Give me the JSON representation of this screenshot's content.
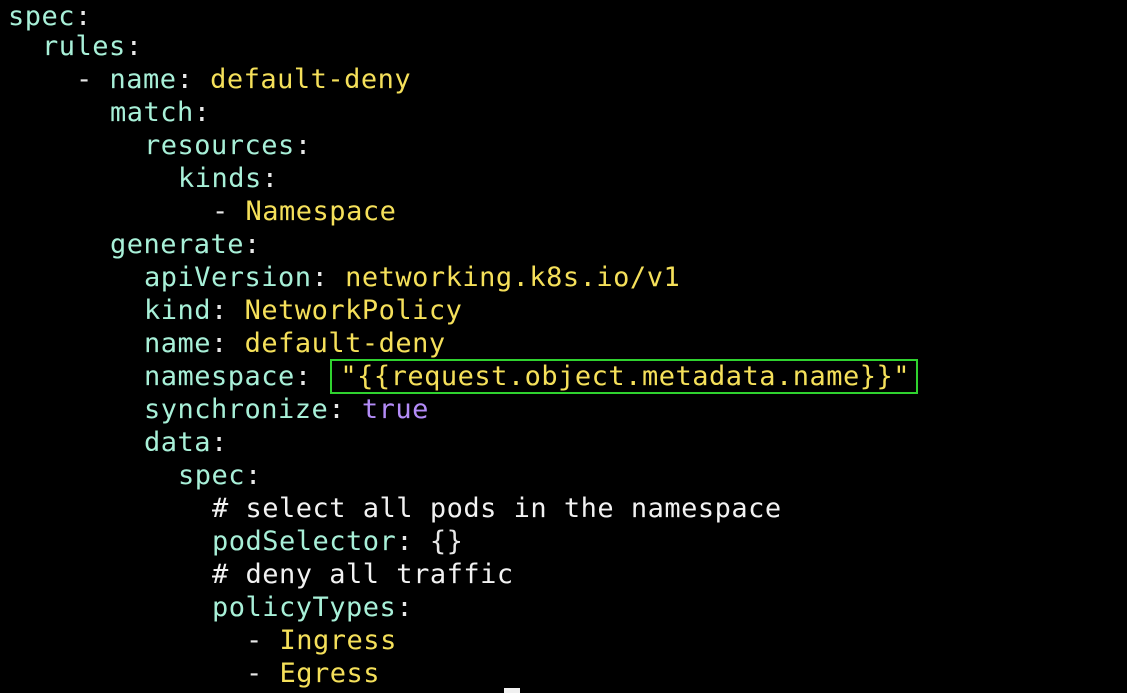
{
  "editor": {
    "lines": {
      "l1": {
        "key": "spec",
        "colon": ":"
      },
      "l2": {
        "key": "rules",
        "colon": ":"
      },
      "l3": {
        "dash": "-",
        "key": "name",
        "colon": ":",
        "value": "default-deny"
      },
      "l4": {
        "key": "match",
        "colon": ":"
      },
      "l5": {
        "key": "resources",
        "colon": ":"
      },
      "l6": {
        "key": "kinds",
        "colon": ":"
      },
      "l7": {
        "dash": "-",
        "value": "Namespace"
      },
      "l8": {
        "key": "generate",
        "colon": ":"
      },
      "l9": {
        "key": "apiVersion",
        "colon": ":",
        "value": "networking.k8s.io/v1"
      },
      "l10": {
        "key": "kind",
        "colon": ":",
        "value": "NetworkPolicy"
      },
      "l11": {
        "key": "name",
        "colon": ":",
        "value": "default-deny"
      },
      "l12": {
        "key": "namespace",
        "colon": ":",
        "value": "\"{{request.object.metadata.name}}\""
      },
      "l13": {
        "key": "synchronize",
        "colon": ":",
        "value": "true"
      },
      "l14": {
        "key": "data",
        "colon": ":"
      },
      "l15": {
        "key": "spec",
        "colon": ":"
      },
      "l16": {
        "comment": "# select all pods in the namespace"
      },
      "l17": {
        "key": "podSelector",
        "colon": ":",
        "value": "{}"
      },
      "l18": {
        "comment": "# deny all traffic"
      },
      "l19": {
        "key": "policyTypes",
        "colon": ":"
      },
      "l20": {
        "dash": "-",
        "value": "Ingress"
      },
      "l21": {
        "dash": "-",
        "value": "Egress"
      }
    }
  },
  "colors": {
    "background": "#000000",
    "key": "#a8f0d8",
    "string": "#f5e05a",
    "boolean": "#b48cf8",
    "highlight_border": "#2fd22f"
  }
}
